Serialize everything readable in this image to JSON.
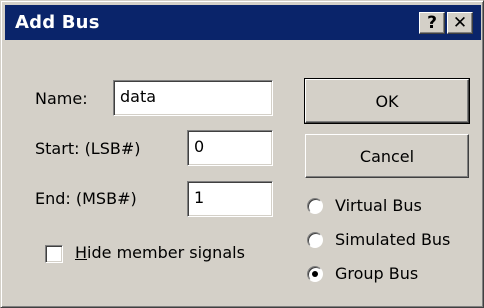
{
  "window": {
    "title": "Add Bus",
    "help_glyph": "?",
    "close_glyph": "✕"
  },
  "form": {
    "name_label": "Name:",
    "name_value": "data",
    "start_label": "Start: (LSB#)",
    "start_value": "0",
    "end_label": "End: (MSB#)",
    "end_value": "1",
    "hide_signals_hotkey": "H",
    "hide_signals_rest": "ide member signals",
    "hide_signals_checked": false
  },
  "buttons": {
    "ok_label": "OK",
    "cancel_label": "Cancel"
  },
  "bus_type": {
    "options": [
      "Virtual Bus",
      "Simulated Bus",
      "Group Bus"
    ],
    "selected": "Group Bus"
  },
  "colors": {
    "titlebar": "#0a246a",
    "face": "#d4d0c8"
  }
}
